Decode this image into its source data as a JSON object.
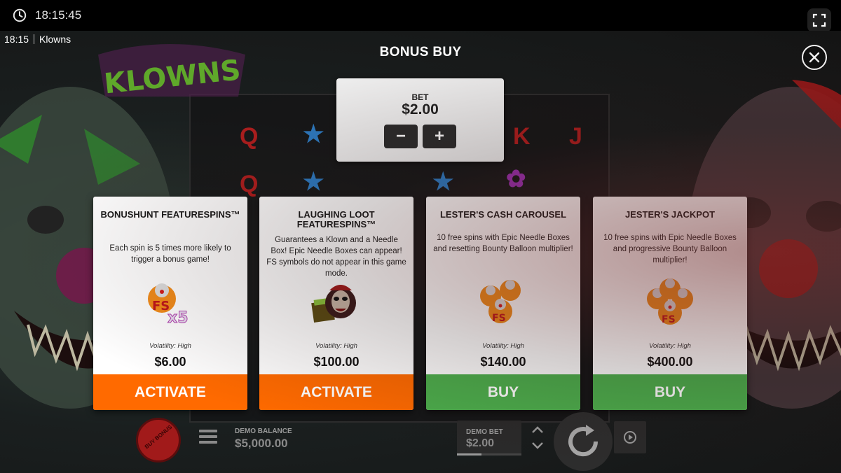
{
  "system": {
    "clock": "18:15:45"
  },
  "game": {
    "time": "18:15",
    "name": "Klowns",
    "logo_text": "KLOWNS"
  },
  "bonus_buy": {
    "title": "BONUS BUY",
    "bet": {
      "label": "BET",
      "value": "$2.00",
      "decrease": "−",
      "increase": "+"
    },
    "cards": [
      {
        "title": "BONUSHUNT FEATURESPINS™",
        "description": "Each spin is 5 times more likely to trigger a bonus game!",
        "icon": "fs-x5-icon",
        "volatility": "Volatility: High",
        "price": "$6.00",
        "button": "ACTIVATE",
        "button_color": "#ff6a00"
      },
      {
        "title": "LAUGHING LOOT FEATURESPINS™",
        "description": "Guarantees a Klown and a Needle Box! Epic Needle Boxes can appear! FS symbols do not appear in this game mode.",
        "icon": "klown-box-icon",
        "volatility": "Volatility: High",
        "price": "$100.00",
        "button": "ACTIVATE",
        "button_color": "#ff6a00"
      },
      {
        "title": "LESTER'S CASH CAROUSEL",
        "description": "10 free spins with Epic Needle Boxes and resetting Bounty Balloon multiplier!",
        "icon": "fs-cluster-icon",
        "volatility": "Volatility: High",
        "price": "$140.00",
        "button": "BUY",
        "button_color": "#4cae4c"
      },
      {
        "title": "JESTER'S JACKPOT",
        "description": "10 free spins with Epic Needle Boxes and progressive Bounty Balloon multiplier!",
        "icon": "fs-cluster-icon",
        "volatility": "Volatility: High",
        "price": "$400.00",
        "button": "BUY",
        "button_color": "#4cae4c"
      }
    ]
  },
  "controls": {
    "buy_bonus": "BUY BONUS",
    "demo_balance_label": "DEMO BALANCE",
    "demo_balance_value": "$5,000.00",
    "demo_bet_label": "DEMO BET",
    "demo_bet_value": "$2.00",
    "demo_bet_level": 0.38
  },
  "colors": {
    "activate": "#ff6a00",
    "buy": "#4cae4c",
    "panel": "#f0f0f0"
  }
}
